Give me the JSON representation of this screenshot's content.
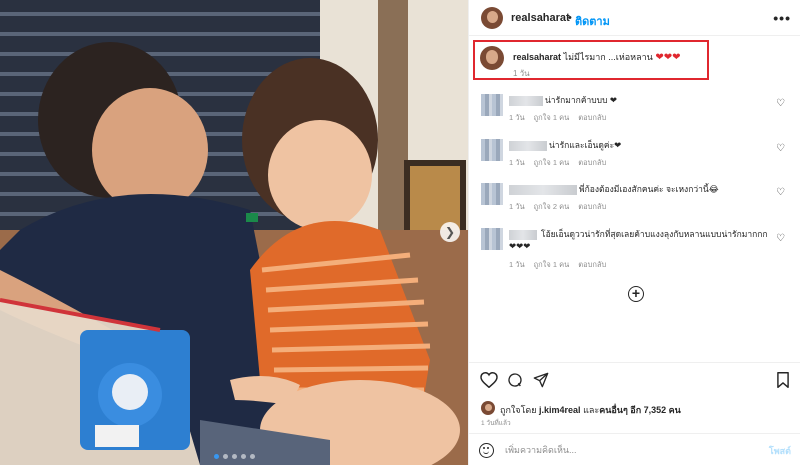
{
  "post": {
    "username": "realsaharat",
    "separator": "•",
    "follow_label": "ติดตาม",
    "more_icon": "more-horizontal-icon"
  },
  "caption": {
    "username": "realsaharat",
    "text": " ไม่มีไรมาก ...เห่อหลาน ",
    "hearts": "❤❤❤",
    "time": "1 วัน",
    "highlight_color": "#e0272f"
  },
  "comments": [
    {
      "text": "น่ารักมากค้าบบบ ❤",
      "time": "1 วัน",
      "likes": "ถูกใจ 1 คน",
      "reply": "ตอบกลับ"
    },
    {
      "text": "น่ารักและเอ็นดูค่ะ❤",
      "time": "1 วัน",
      "likes": "ถูกใจ 1 คน",
      "reply": "ตอบกลับ"
    },
    {
      "text": "พี่ก้องต้องมีเองสักคนค่ะ จะเหงกว่านี้😂",
      "time": "1 วัน",
      "likes": "ถูกใจ 2 คน",
      "reply": "ตอบกลับ"
    },
    {
      "text": "โอ้ยเอ็นดูววน่ารักที่สุดเลยค้าบแงงลุงกับหลานแบบน่ารักมากกก❤❤❤",
      "time": "1 วัน",
      "likes": "ถูกใจ 1 คน",
      "reply": "ตอบกลับ"
    }
  ],
  "load_more_icon": "plus-circle-icon",
  "likes": {
    "prefix": "ถูกใจโดย ",
    "user": "j.kim4real",
    "middle": " และ",
    "others": "คนอื่นๆ อีก 7,352 คน"
  },
  "date": "1 วันที่แล้ว",
  "comment_input": {
    "placeholder": "เพิ่มความคิดเห็น...",
    "post_label": "โพสต์"
  },
  "colors": {
    "accent": "#0095f6",
    "heart": "#e0272f",
    "muted": "#8e8e8e"
  }
}
